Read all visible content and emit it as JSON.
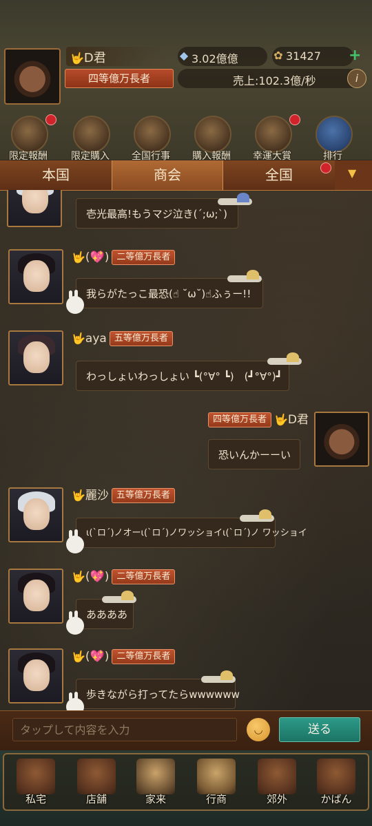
{
  "player": {
    "name": "D君",
    "rank": "四等億万長者",
    "silver": "3.02億億",
    "food": "31427",
    "sales": "売上:102.3億/秒",
    "info_icon": "info-icon",
    "plus_icon": "plus-icon"
  },
  "features": [
    {
      "label": "限定報酬",
      "dot": true
    },
    {
      "label": "限定購入",
      "dot": false
    },
    {
      "label": "全国行事",
      "dot": false
    },
    {
      "label": "購入報酬",
      "dot": false
    },
    {
      "label": "幸運大賞",
      "dot": true
    },
    {
      "label": "排行",
      "dot": false
    }
  ],
  "tabs": {
    "kuni": "本国",
    "shokai": "商会",
    "zenkoku": "全国",
    "active": "商会",
    "dropdown_icon": "▼"
  },
  "messages": [
    {
      "side": "left",
      "name": "",
      "rank": "",
      "text": "壱光最高!もうマジ泣き(´;ω;`)"
    },
    {
      "side": "left",
      "name": "(💖)",
      "rank": "二等億万長者",
      "text": "我らがたっこ最恐(☝ ˘ω˘)☝ふぅー!!"
    },
    {
      "side": "left",
      "name": "aya",
      "rank": "五等億万長者",
      "text": "わっしょいわっしょい ┗(°∀° ┗)　(┛°∀°)┛"
    },
    {
      "side": "right",
      "name": "D君",
      "rank": "四等億万長者",
      "text": "恐いんかーーい"
    },
    {
      "side": "left",
      "name": "麗沙",
      "rank": "五等億万長者",
      "text": "ι(`ロ´)ノオーι(`ロ´)ノワッショイι(`ロ´)ノ ワッショイ"
    },
    {
      "side": "left",
      "name": "(💖)",
      "rank": "二等億万長者",
      "text": "ああああ"
    },
    {
      "side": "left",
      "name": "(💖)",
      "rank": "二等億万長者",
      "text": "歩きながら打ってたらwwwwww"
    }
  ],
  "input": {
    "placeholder": "タップして内容を入力",
    "send_label": "送る",
    "emoji_icon": "smiley-face-icon"
  },
  "bottom_nav": [
    {
      "label": "私宅"
    },
    {
      "label": "店舗"
    },
    {
      "label": "家来"
    },
    {
      "label": "行商"
    },
    {
      "label": "郊外"
    },
    {
      "label": "かばん"
    }
  ]
}
